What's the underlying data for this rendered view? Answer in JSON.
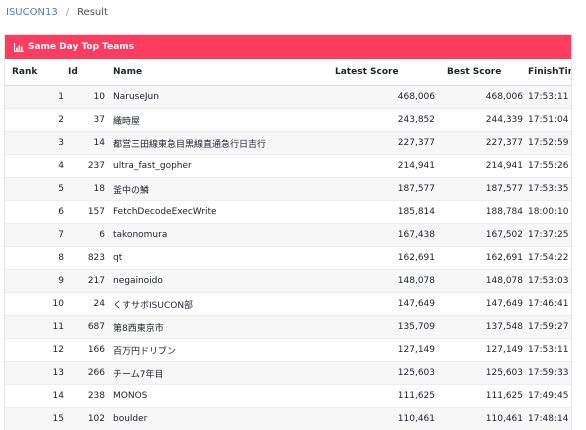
{
  "breadcrumb": {
    "home": "ISUCON13",
    "separator": "/",
    "current": "Result"
  },
  "card": {
    "title": "Same Day Top Teams",
    "icon": "chart-icon",
    "header_color": "#fd3c5f"
  },
  "table": {
    "headers": {
      "rank": "Rank",
      "id": "Id",
      "name": "Name",
      "latest": "Latest Score",
      "best": "Best Score",
      "finish": "FinishTime"
    },
    "rows": [
      {
        "rank": "1",
        "id": "10",
        "name": "NaruseJun",
        "latest": "468,006",
        "best": "468,006",
        "finish": "17:53:11"
      },
      {
        "rank": "2",
        "id": "37",
        "name": "織時屋",
        "latest": "243,852",
        "best": "244,339",
        "finish": "17:51:04"
      },
      {
        "rank": "3",
        "id": "14",
        "name": "都営三田線東急目黒線直通急行日吉行",
        "latest": "227,377",
        "best": "227,377",
        "finish": "17:52:59"
      },
      {
        "rank": "4",
        "id": "237",
        "name": "ultra_fast_gopher",
        "latest": "214,941",
        "best": "214,941",
        "finish": "17:55:26"
      },
      {
        "rank": "5",
        "id": "18",
        "name": "釜中の鱗",
        "latest": "187,577",
        "best": "187,577",
        "finish": "17:53:35"
      },
      {
        "rank": "6",
        "id": "157",
        "name": "FetchDecodeExecWrite",
        "latest": "185,814",
        "best": "188,784",
        "finish": "18:00:10"
      },
      {
        "rank": "7",
        "id": "6",
        "name": "takonomura",
        "latest": "167,438",
        "best": "167,502",
        "finish": "17:37:25"
      },
      {
        "rank": "8",
        "id": "823",
        "name": "qt",
        "latest": "162,691",
        "best": "162,691",
        "finish": "17:54:22"
      },
      {
        "rank": "9",
        "id": "217",
        "name": "negainoido",
        "latest": "148,078",
        "best": "148,078",
        "finish": "17:53:03"
      },
      {
        "rank": "10",
        "id": "24",
        "name": "くすサボISUCON部",
        "latest": "147,649",
        "best": "147,649",
        "finish": "17:46:41"
      },
      {
        "rank": "11",
        "id": "687",
        "name": "第8西東京市",
        "latest": "135,709",
        "best": "137,548",
        "finish": "17:59:27"
      },
      {
        "rank": "12",
        "id": "166",
        "name": "百万円ドリブン",
        "latest": "127,149",
        "best": "127,149",
        "finish": "17:53:11"
      },
      {
        "rank": "13",
        "id": "266",
        "name": "チーム7年目",
        "latest": "125,603",
        "best": "125,603",
        "finish": "17:59:33"
      },
      {
        "rank": "14",
        "id": "238",
        "name": "MONOS",
        "latest": "111,625",
        "best": "111,625",
        "finish": "17:49:45"
      },
      {
        "rank": "15",
        "id": "102",
        "name": "boulder",
        "latest": "110,461",
        "best": "110,461",
        "finish": "17:48:14"
      }
    ]
  }
}
